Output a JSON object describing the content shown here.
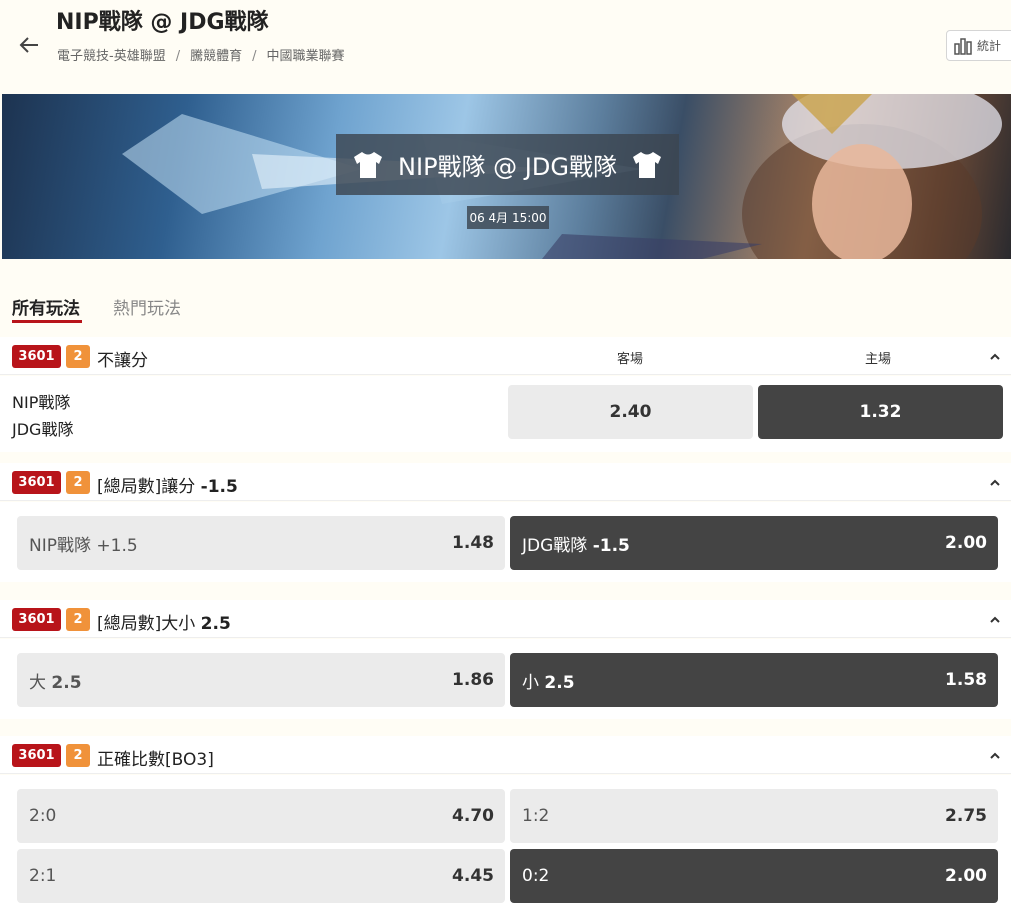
{
  "header": {
    "title": "NIP戰隊 @ JDG戰隊",
    "breadcrumb": [
      "電子競技-英雄聯盟",
      "騰競體育",
      "中國職業聯賽"
    ],
    "stats_label": "統計"
  },
  "banner": {
    "title": "NIP戰隊 @ JDG戰隊",
    "date": "06 4月 15:00"
  },
  "tabs": [
    {
      "label": "所有玩法",
      "active": true
    },
    {
      "label": "熱門玩法",
      "active": false
    }
  ],
  "markets": [
    {
      "id_badge": "3601",
      "num_badge": "2",
      "name": "不讓分",
      "columns": [
        "客場",
        "主場"
      ],
      "teams": [
        "NIP戰隊",
        "JDG戰隊"
      ],
      "odds": [
        {
          "label": "",
          "value": "2.40",
          "style": "light"
        },
        {
          "label": "",
          "value": "1.32",
          "style": "dark"
        }
      ]
    },
    {
      "id_badge": "3601",
      "num_badge": "2",
      "name_prefix": "[總局數]讓分",
      "name_value": "-1.5",
      "odds": [
        {
          "label_text": "NIP戰隊",
          "label_num": "+1.5",
          "value": "1.48",
          "style": "light"
        },
        {
          "label_text": "JDG戰隊",
          "label_num": "-1.5",
          "value": "2.00",
          "style": "dark"
        }
      ]
    },
    {
      "id_badge": "3601",
      "num_badge": "2",
      "name_prefix": "[總局數]大小",
      "name_value": "2.5",
      "odds": [
        {
          "label_text": "大",
          "label_num": "2.5",
          "value": "1.86",
          "style": "light"
        },
        {
          "label_text": "小",
          "label_num": "2.5",
          "value": "1.58",
          "style": "dark"
        }
      ]
    },
    {
      "id_badge": "3601",
      "num_badge": "2",
      "name": "正確比數[BO3]",
      "odds": [
        {
          "label": "2:0",
          "value": "4.70",
          "style": "light"
        },
        {
          "label": "1:2",
          "value": "2.75",
          "style": "light"
        },
        {
          "label": "2:1",
          "value": "4.45",
          "style": "light"
        },
        {
          "label": "0:2",
          "value": "2.00",
          "style": "dark"
        }
      ]
    }
  ],
  "colors": {
    "brand_red": "#b8141a",
    "badge_orange": "#f0923a",
    "odd_dark": "#444444",
    "odd_light": "#ebebeb"
  }
}
